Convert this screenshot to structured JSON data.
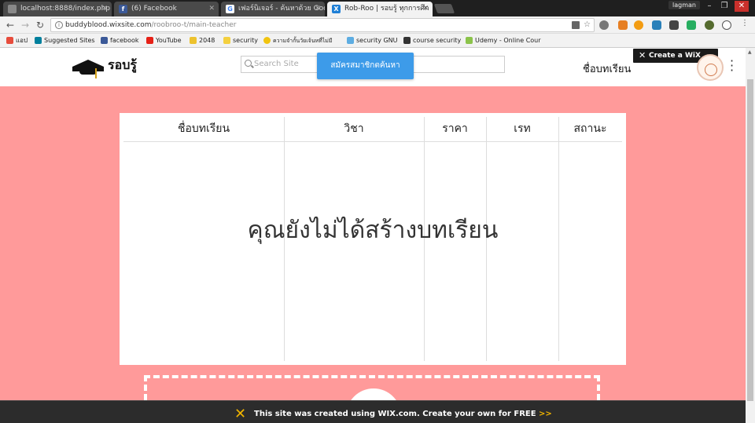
{
  "browser": {
    "tabs": [
      {
        "title": "localhost:8888/index.php",
        "icon": "page-icon",
        "active": false
      },
      {
        "title": "(6) Facebook",
        "icon": "facebook-icon",
        "active": false
      },
      {
        "title": "เฟอร์นิเจอร์ - ค้นหาด้วย Goo",
        "icon": "google-icon",
        "active": false
      },
      {
        "title": "Rob-Roo | รอบรู้ ทุกการศึก",
        "icon": "wix-icon",
        "active": true
      }
    ],
    "profile": "lagman",
    "url_host": "buddyblood.wixsite.com",
    "url_path": "/roobroo-t/main-teacher",
    "bookmarks": [
      "แอป",
      "Suggested Sites",
      "facebook",
      "YouTube",
      "2048",
      "security",
      "ความจำกั้นวัยเจ้นหที่ไม่มี",
      "security GNU",
      "course security",
      "Udemy - Online Cour"
    ]
  },
  "site": {
    "logo_text": "รอบรู้",
    "search_placeholder": "Search Site",
    "signup_button": "สมัครสมาชิกตค้นหา",
    "nav_link": "ชื่อบทเรียน",
    "wix_badge": "Create a WiX site!"
  },
  "table": {
    "columns": [
      "ชื่อบทเรียน",
      "วิชา",
      "ราคา",
      "เรท",
      "สถานะ"
    ],
    "empty_message": "คุณยังไม่ได้สร้างบทเรียน"
  },
  "footer": {
    "text": "This site was created using WIX.com. Create your own for FREE",
    "arrows": ">>"
  },
  "colors": {
    "page_background": "#ff9a9a",
    "button_blue": "#3d9be9",
    "footer_bg": "#2c2c2c"
  }
}
